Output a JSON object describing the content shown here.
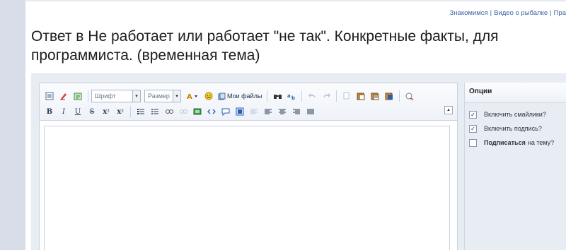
{
  "header": {
    "links": [
      "Знакомимся",
      "Видео о рыбалке",
      "Пра"
    ],
    "separator": "|"
  },
  "page_title": "Ответ в Не работает или работает \"не так\". Конкретные факты, для программиста. (временная тема)",
  "editor": {
    "toolbar_row1": {
      "font_select": "Шрифт",
      "size_select": "Размер",
      "my_files_label": "Мои файлы"
    },
    "toolbar_row2": {
      "bold": "B",
      "italic": "I",
      "underline": "U",
      "strike": "S",
      "subscript": "x",
      "superscript": "x"
    },
    "body_text": ""
  },
  "options": {
    "title": "Опции",
    "items": [
      {
        "label": "Включить смайлики?",
        "checked": true
      },
      {
        "label": "Включить подпись?",
        "checked": true
      },
      {
        "label_bold": "Подписаться",
        "label_rest": "на тему?",
        "checked": false
      }
    ]
  },
  "colors": {
    "link": "#3a63a8",
    "panel_bg": "#e8ecf3",
    "left_strip": "#d8dde9"
  }
}
